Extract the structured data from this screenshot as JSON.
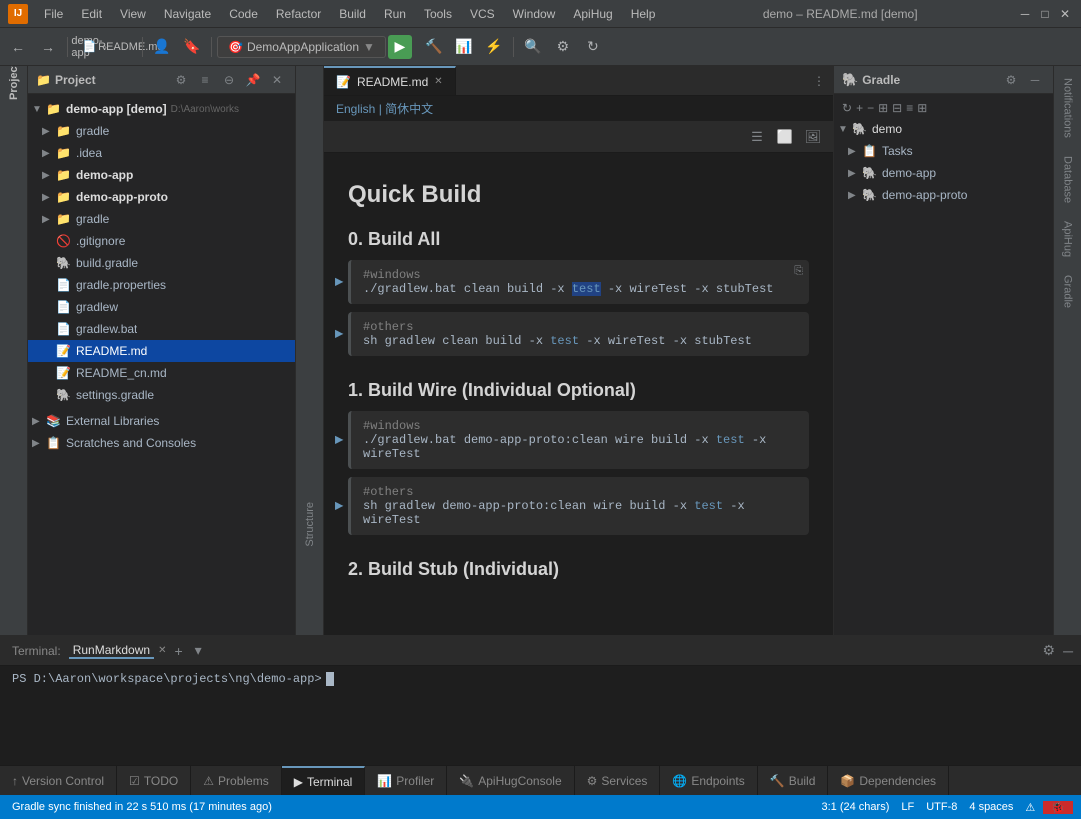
{
  "titleBar": {
    "title": "demo – README.md [demo]",
    "menus": [
      "File",
      "Edit",
      "View",
      "Navigate",
      "Code",
      "Refactor",
      "Build",
      "Run",
      "Tools",
      "VCS",
      "Window",
      "ApiHug",
      "Help"
    ]
  },
  "breadcrumb": {
    "project": "demo-app",
    "separator": "›",
    "file": "README.md"
  },
  "projectPanel": {
    "title": "Project",
    "rootLabel": "demo-app [demo]",
    "rootPath": "D:\\Aaron\\works",
    "items": [
      {
        "indent": 1,
        "label": "gradle",
        "type": "folder",
        "expanded": true
      },
      {
        "indent": 1,
        "label": ".idea",
        "type": "folder",
        "expanded": false
      },
      {
        "indent": 1,
        "label": "demo-app",
        "type": "folder",
        "expanded": false,
        "bold": true
      },
      {
        "indent": 1,
        "label": "demo-app-proto",
        "type": "folder",
        "expanded": false,
        "bold": true
      },
      {
        "indent": 1,
        "label": "gradle",
        "type": "folder",
        "expanded": false
      },
      {
        "indent": 1,
        "label": ".gitignore",
        "type": "gitignore"
      },
      {
        "indent": 1,
        "label": "build.gradle",
        "type": "gradle"
      },
      {
        "indent": 1,
        "label": "gradle.properties",
        "type": "file"
      },
      {
        "indent": 1,
        "label": "gradlew",
        "type": "file"
      },
      {
        "indent": 1,
        "label": "gradlew.bat",
        "type": "file"
      },
      {
        "indent": 1,
        "label": "README.md",
        "type": "md",
        "selected": true
      },
      {
        "indent": 1,
        "label": "README_cn.md",
        "type": "md"
      },
      {
        "indent": 1,
        "label": "settings.gradle",
        "type": "gradle"
      },
      {
        "indent": 0,
        "label": "External Libraries",
        "type": "folder",
        "expanded": false
      },
      {
        "indent": 0,
        "label": "Scratches and Consoles",
        "type": "folder",
        "expanded": false
      }
    ]
  },
  "editorTab": {
    "label": "README.md",
    "active": true
  },
  "langBar": {
    "english": "English",
    "separator": "|",
    "chinese": "简休中文"
  },
  "editorContent": {
    "title": "Quick Build",
    "sections": [
      {
        "heading": "0. Build All",
        "codeBlocks": [
          {
            "comment": "#windows",
            "command": "./gradlew.bat clean build -x test -x wireTest -x stubTest"
          },
          {
            "comment": "#others",
            "command": "sh gradlew clean build -x test -x wireTest -x stubTest"
          }
        ]
      },
      {
        "heading": "1. Build Wire (Individual Optional)",
        "codeBlocks": [
          {
            "comment": "#windows",
            "command": "./gradlew.bat demo-app-proto:clean wire build -x test -x wireTest"
          },
          {
            "comment": "#others",
            "command": "sh gradlew demo-app-proto:clean wire build -x test -x wireTest"
          }
        ]
      },
      {
        "heading": "2. Build Stub (Individual)",
        "codeBlocks": []
      }
    ]
  },
  "gradlePanel": {
    "title": "Gradle",
    "items": [
      {
        "label": "demo",
        "type": "root",
        "indent": 0,
        "expanded": true
      },
      {
        "label": "Tasks",
        "type": "folder",
        "indent": 1,
        "expanded": false
      },
      {
        "label": "demo-app",
        "type": "module",
        "indent": 1,
        "expanded": false
      },
      {
        "label": "demo-app-proto",
        "type": "module",
        "indent": 1,
        "expanded": false
      }
    ]
  },
  "terminal": {
    "tabLabel": "Terminal:",
    "activeTab": "RunMarkdown",
    "prompt": "PS D:\\Aaron\\workspace\\projects\\ng\\demo-app>"
  },
  "bottomTabs": [
    {
      "label": "Version Control",
      "icon": "↑",
      "active": false
    },
    {
      "label": "TODO",
      "icon": "☑",
      "active": false
    },
    {
      "label": "Problems",
      "icon": "⚠",
      "active": false
    },
    {
      "label": "Terminal",
      "icon": "▶",
      "active": true
    },
    {
      "label": "Profiler",
      "icon": "📊",
      "active": false
    },
    {
      "label": "ApiHugConsole",
      "icon": "🔌",
      "active": false
    },
    {
      "label": "Services",
      "icon": "⚙",
      "active": false
    },
    {
      "label": "Endpoints",
      "icon": "🌐",
      "active": false
    },
    {
      "label": "Build",
      "icon": "🔨",
      "active": false
    },
    {
      "label": "Dependencies",
      "icon": "📦",
      "active": false
    }
  ],
  "statusBar": {
    "message": "Gradle sync finished in 22 s 510 ms (17 minutes ago)",
    "position": "3:1 (24 chars)",
    "lineEnding": "LF",
    "encoding": "UTF-8",
    "indent": "4 spaces"
  },
  "rightSidebar": {
    "items": [
      "Notifications",
      "Database",
      "ApiHug",
      "Gradle"
    ]
  }
}
